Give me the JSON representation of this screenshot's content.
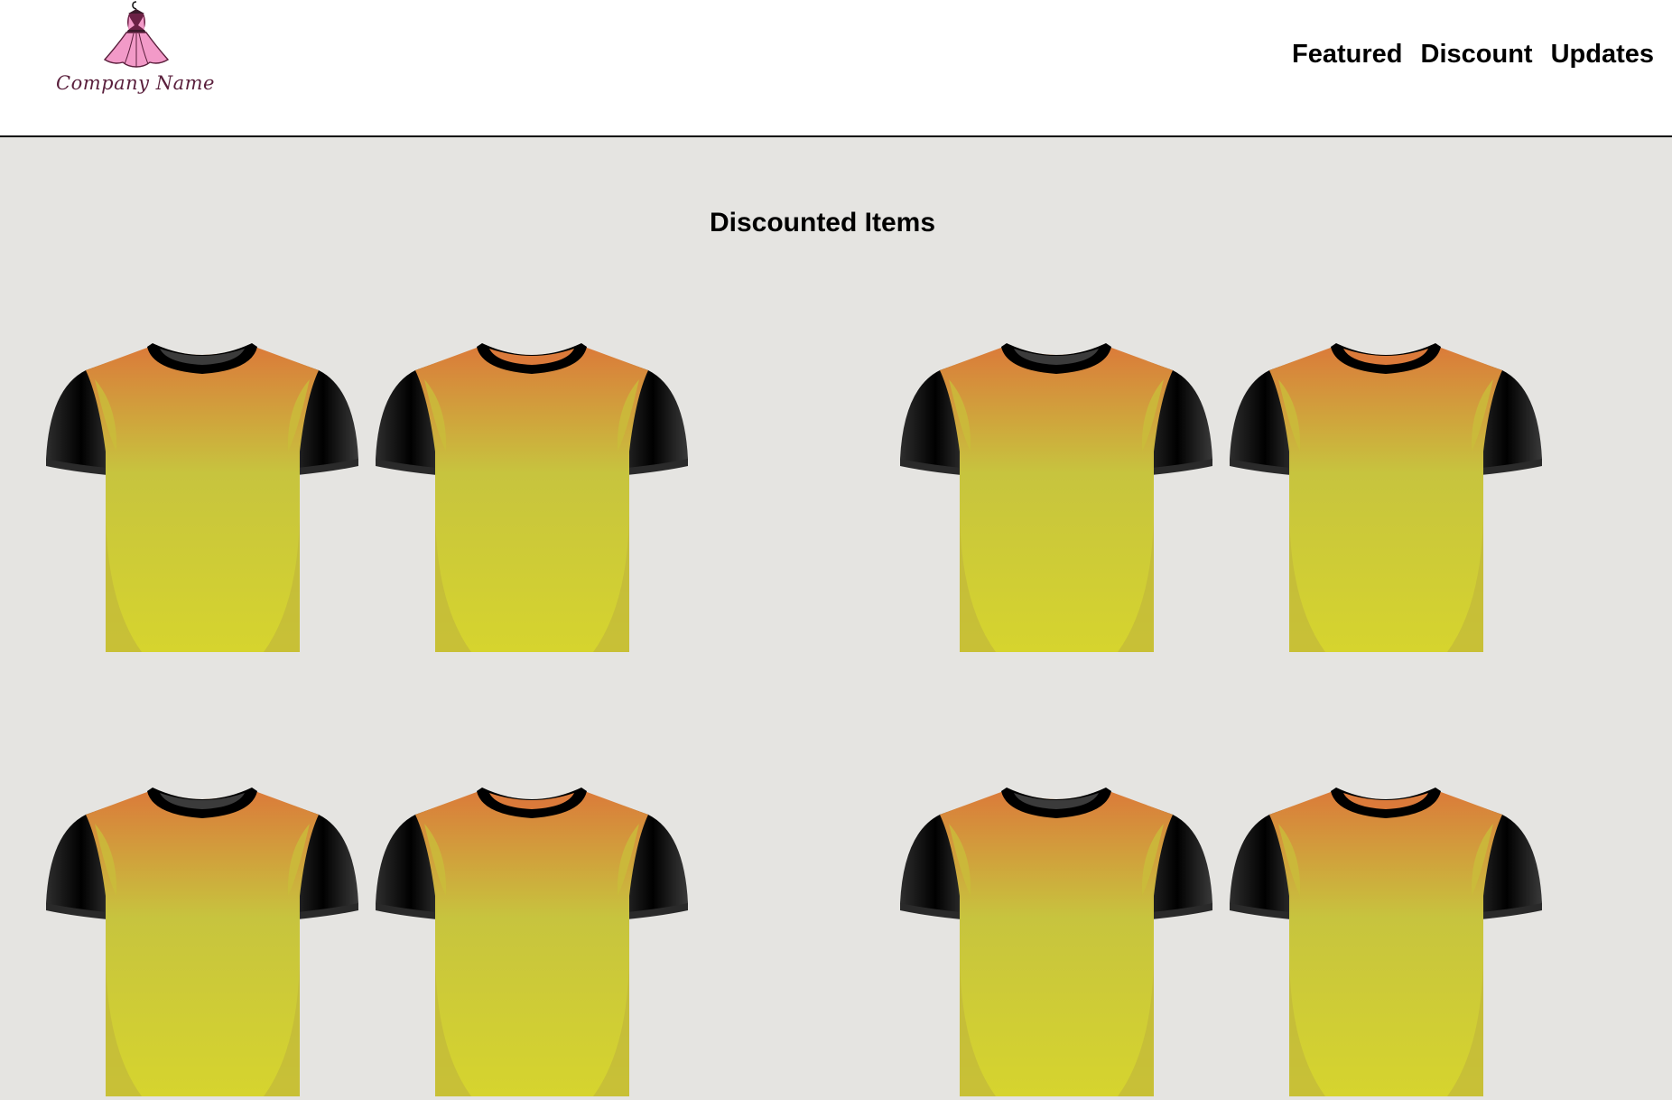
{
  "header": {
    "logo_text": "Company Name",
    "nav": [
      {
        "label": "Featured"
      },
      {
        "label": "Discount"
      },
      {
        "label": "Updates"
      }
    ]
  },
  "main": {
    "section_title": "Discounted Items",
    "products": [
      {
        "image": "tshirt-orange-yellow",
        "collar": "dark"
      },
      {
        "image": "tshirt-orange-yellow",
        "collar": "light"
      },
      {
        "image": "tshirt-orange-yellow",
        "collar": "dark"
      },
      {
        "image": "tshirt-orange-yellow",
        "collar": "light"
      },
      {
        "image": "tshirt-orange-yellow",
        "collar": "dark"
      },
      {
        "image": "tshirt-orange-yellow",
        "collar": "light"
      },
      {
        "image": "tshirt-orange-yellow",
        "collar": "dark"
      },
      {
        "image": "tshirt-orange-yellow",
        "collar": "light"
      }
    ]
  },
  "colors": {
    "page_background": "#e5e4e1",
    "header_background": "#ffffff",
    "shirt_top": "#db7a3a",
    "shirt_bottom": "#d6d42e",
    "sleeve": "#1a1a1a",
    "logo_dress": "#f29ac8"
  }
}
